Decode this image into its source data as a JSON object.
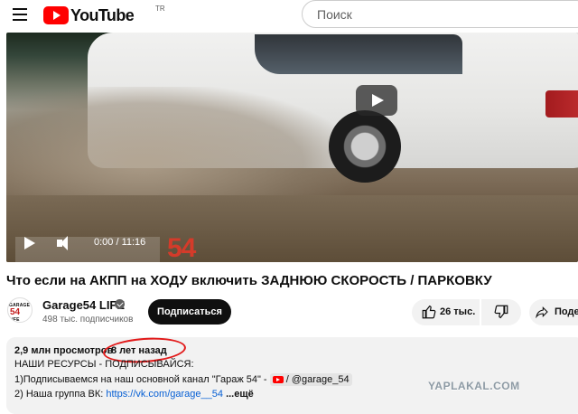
{
  "header": {
    "logo_text": "YouTube",
    "logo_sup": "TR",
    "search_placeholder": "Поиск"
  },
  "player": {
    "time": "0:00 / 11:16",
    "watermark_number": "54"
  },
  "video": {
    "title": "Что если на АКПП на ХОДУ включить ЗАДНЮЮ СКОРОСТЬ / ПАРКОВКУ"
  },
  "channel": {
    "avatar_top": "GARAGE",
    "avatar_num": "54",
    "avatar_bottom": "LIFE",
    "name": "Garage54 LIFE",
    "subscribers": "498 тыс. подписчиков",
    "subscribe_label": "Подписаться"
  },
  "actions": {
    "likes": "26 тыс.",
    "share_label": "Поде"
  },
  "description": {
    "views": "2,9 млн просмотров",
    "age": "8 лет назад",
    "line1": "НАШИ РЕСУРСЫ - ПОДПИСЫВАЙСЯ:",
    "line2_prefix": "1)Подписываемся на наш основной канал \"Гараж 54\" -",
    "line2_handle": "/ @garage_54",
    "line3_prefix": "2) Наша группа ВК:",
    "line3_link": "https://vk.com/garage__54",
    "line3_more": "...ещё"
  },
  "overlay": {
    "site_watermark": "YAPLAKAL.COM",
    "annotation_color": "#e21a1a"
  }
}
